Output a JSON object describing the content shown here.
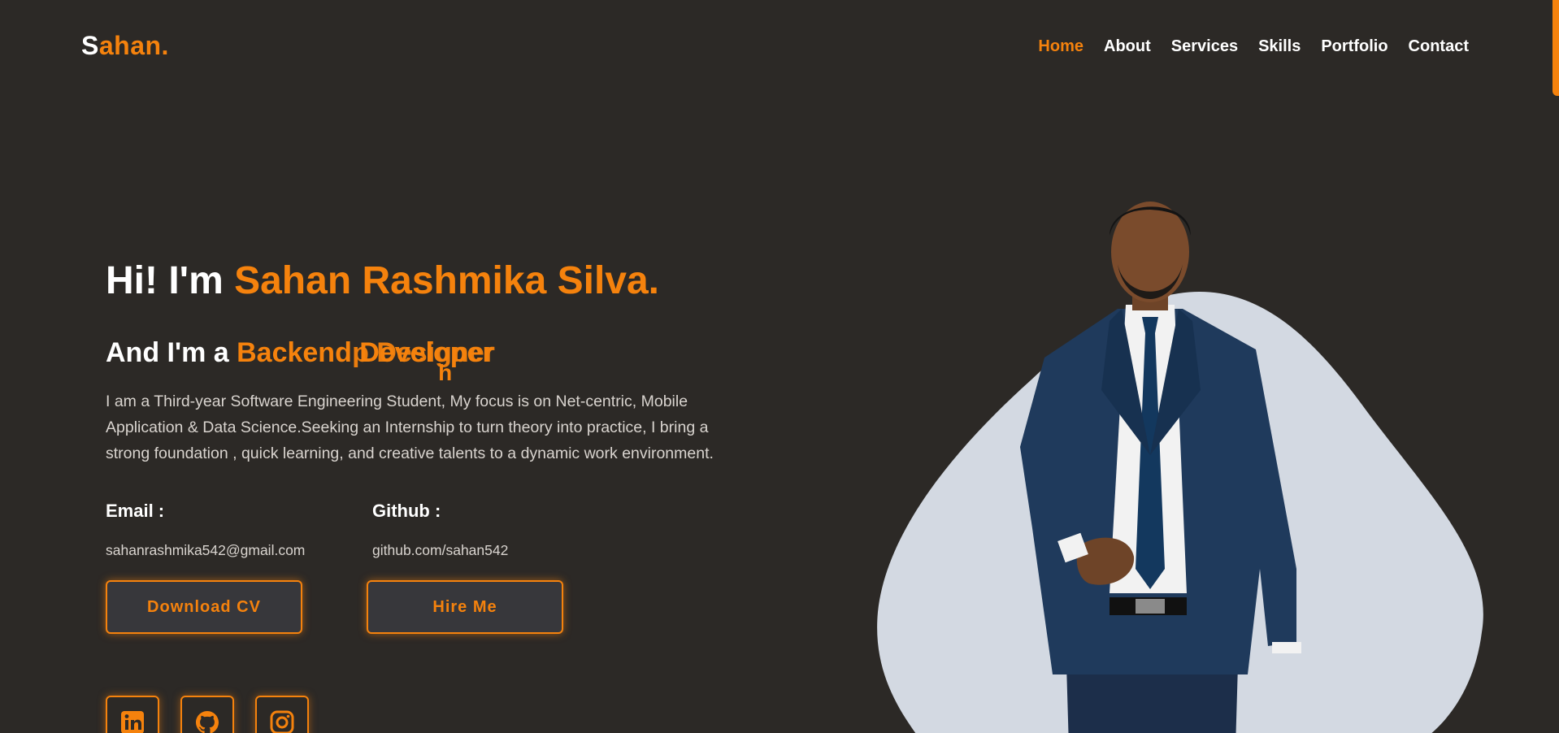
{
  "brand": {
    "logo_first": "S",
    "logo_rest": "ahan."
  },
  "nav": {
    "items": [
      {
        "label": "Home",
        "active": true
      },
      {
        "label": "About",
        "active": false
      },
      {
        "label": "Services",
        "active": false
      },
      {
        "label": "Skills",
        "active": false
      },
      {
        "label": "Portfolio",
        "active": false
      },
      {
        "label": "Contact",
        "active": false
      }
    ]
  },
  "hero": {
    "greeting": "Hi! I'm ",
    "name": "Sahan Rashmika Silva.",
    "role_prefix": "And I'm a ",
    "role_primary": "Backend Developer",
    "role_overlay": "Designer",
    "role_fragment": "p",
    "role_drop": "h",
    "bio": "I am a Third-year Software Engineering Student, My focus is on Net-centric, Mobile Application & Data Science.Seeking an Internship to turn theory into practice, I bring a strong foundation , quick learning, and creative talents to a dynamic work environment."
  },
  "contact": {
    "email_label": "Email :",
    "email_value": "sahanrashmika542@gmail.com",
    "github_label": "Github :",
    "github_value": "github.com/sahan542"
  },
  "buttons": {
    "download_cv": "Download CV",
    "hire_me": "Hire Me"
  },
  "social": {
    "icons": [
      "linkedin-icon",
      "github-icon",
      "instagram-icon"
    ]
  },
  "colors": {
    "background": "#2c2926",
    "accent": "#f5820d",
    "blob": "#d3d9e2",
    "button_bg": "#37373b"
  }
}
